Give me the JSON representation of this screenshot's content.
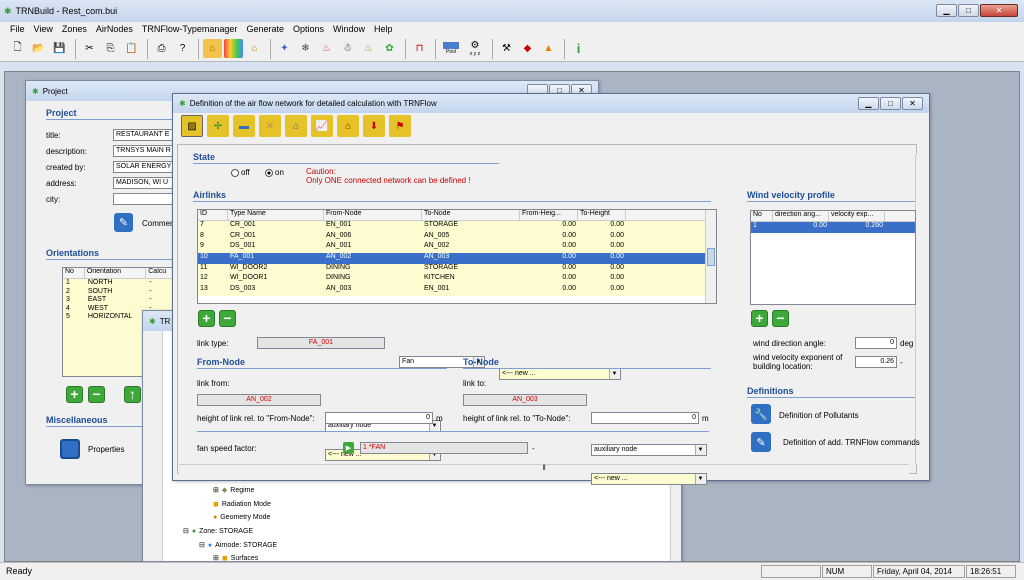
{
  "app": {
    "title": "TRNBuild - Rest_com.bui"
  },
  "menu": [
    "File",
    "View",
    "Zones",
    "AirNodes",
    "TRNFlow-Typemanager",
    "Generate",
    "Options",
    "Window",
    "Help"
  ],
  "toolbar_icons": [
    "new-file-icon",
    "open-file-icon",
    "save-icon",
    "cut-icon",
    "copy-icon",
    "paste-icon",
    "print-icon",
    "help-icon",
    "building-icon",
    "wall-types-icon",
    "house-icon",
    "ventilation-icon",
    "cooling-icon",
    "heating-icon",
    "gains-icon",
    "comfort-icon",
    "humidity-icon",
    "schedule-icon",
    "pool-icon",
    "xyz-icon",
    "tools-icon",
    "3d-view-icon",
    "mesh-icon",
    "info-icon"
  ],
  "toolbar_labels": {
    "pool": "Pool",
    "xyz": "x y z"
  },
  "project": {
    "window_title": "Project",
    "section": "Project",
    "fields": [
      {
        "label": "title:",
        "value": "RESTAURANT E"
      },
      {
        "label": "description:",
        "value": "TRNSYS MAIN R"
      },
      {
        "label": "created by:",
        "value": "SOLAR ENERGY"
      },
      {
        "label": "address:",
        "value": "MADISON, WI  U"
      },
      {
        "label": "city:",
        "value": ""
      }
    ],
    "comment_label": "Comment",
    "orientations_title": "Orientations",
    "orient_headers": [
      "No",
      "Orientation",
      "Calcu"
    ],
    "orientations": [
      [
        "1",
        "NORTH",
        "-"
      ],
      [
        "2",
        "SOUTH",
        "-"
      ],
      [
        "3",
        "EAST",
        "-"
      ],
      [
        "4",
        "WEST",
        "-"
      ],
      [
        "5",
        "HORIZONTAL",
        "-"
      ]
    ],
    "misc_title": "Miscellaneous",
    "properties_label": "Properties"
  },
  "tree_window": {
    "title": "TR",
    "items": [
      {
        "label": "Regime"
      },
      {
        "label": "Radiation Mode"
      },
      {
        "label": "Geometry Mode"
      },
      {
        "label": "Zone: STORAGE"
      },
      {
        "label": "Airnode: STORAGE"
      },
      {
        "label": "Surfaces"
      }
    ]
  },
  "dialog": {
    "title": "Definition of the air flow network for detailed calculation with TRNFlow",
    "state": {
      "title": "State",
      "off": "off",
      "on": "on",
      "caution1": "Caution:",
      "caution2": "Only ONE connected network can be defined !"
    },
    "airlinks": {
      "title": "Airlinks",
      "headers": [
        "ID",
        "Type Name",
        "From-Node",
        "To-Node",
        "From-Heig...",
        "To-Height"
      ],
      "rows": [
        [
          "7",
          "CR_001",
          "EN_001",
          "STORAGE",
          "0.00",
          "0.00"
        ],
        [
          "8",
          "CR_001",
          "AN_006",
          "AN_005",
          "0.00",
          "0.00"
        ],
        [
          "9",
          "DS_001",
          "AN_001",
          "AN_002",
          "0.00",
          "0.00"
        ],
        [
          "10",
          "FA_001",
          "AN_002",
          "AN_003",
          "0.00",
          "0.00"
        ],
        [
          "11",
          "WI_DOOR2",
          "DINING",
          "STORAGE",
          "0.00",
          "0.00"
        ],
        [
          "12",
          "WI_DOOR1",
          "DINING",
          "KITCHEN",
          "0.00",
          "0.00"
        ],
        [
          "13",
          "DS_003",
          "AN_003",
          "EN_001",
          "0.00",
          "0.00"
        ]
      ],
      "selected_index": 3
    },
    "link_type_label": "link type:",
    "link_type_value": "FA_001",
    "link_kind": "Fan",
    "link_new": "<--- new ...",
    "from": {
      "title": "From-Node",
      "link_label": "link from:",
      "kind": "auxiliary node",
      "node": "AN_002",
      "new": "<--- new ...",
      "height_label": "height of link rel. to \"From-Node\":",
      "height": "0",
      "unit": "m"
    },
    "to": {
      "title": "To-Node",
      "link_label": "link to:",
      "kind": "auxiliary node",
      "node": "AN_003",
      "new": "<--- new ...",
      "height_label": "height of link rel. to \"To-Node\":",
      "height": "0",
      "unit": "m"
    },
    "fan_label": "fan speed factor:",
    "fan_value": "1 *FAN",
    "fan_dash": "-",
    "wind": {
      "title": "Wind velocity profile",
      "headers": [
        "No",
        "direction ang...",
        "velocity exp..."
      ],
      "rows": [
        [
          "1",
          "0.00",
          "0.260"
        ]
      ],
      "direction_label": "wind direction angle:",
      "direction": "0",
      "direction_unit": "deg",
      "exponent_label1": "wind velocity exponent of",
      "exponent_label2": "building location:",
      "exponent": "0.26",
      "exponent_unit": "-"
    },
    "definitions": {
      "title": "Definitions",
      "pollutants": "Definition of Pollutants",
      "commands": "Definition of add. TRNFlow commands"
    }
  },
  "status": {
    "ready": "Ready",
    "num": "NUM",
    "date": "Friday, April 04, 2014",
    "time": "18:26:51"
  },
  "colors": {
    "selection": "#3a6fc9",
    "row_bg": "#fdfbd0",
    "section": "#1f4e9a"
  }
}
